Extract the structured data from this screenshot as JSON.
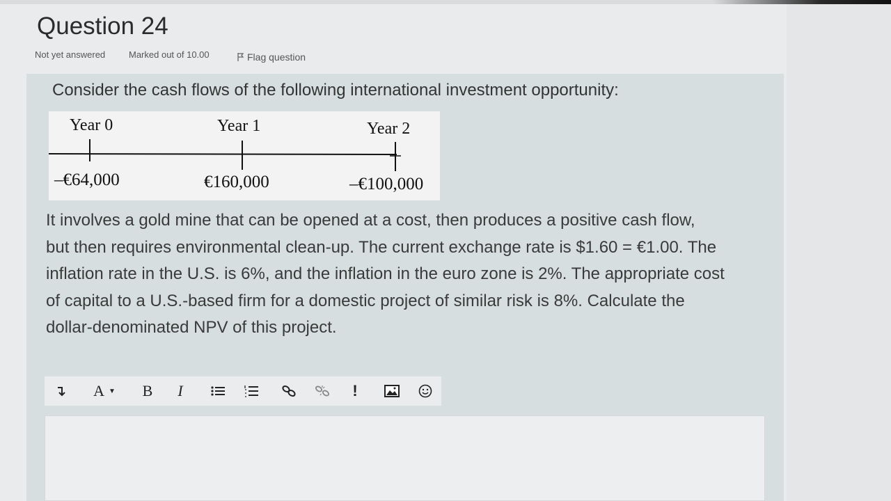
{
  "question": {
    "title": "Question 24",
    "status": "Not yet answered",
    "marks": "Marked out of 10.00",
    "flag_label": "Flag question"
  },
  "prompt": {
    "lead": "Consider the cash flows of the following international investment opportunity:",
    "timeline": {
      "years": [
        "Year 0",
        "Year 1",
        "Year 2"
      ],
      "cash_flows": [
        "–€64,000",
        "€160,000",
        "–€100,000"
      ]
    },
    "paragraph_lines": [
      "It involves a gold mine that can be opened at a cost, then produces a positive cash flow,",
      "but then requires environmental clean-up. The current exchange rate is $1.60 = €1.00. The",
      "inflation rate in the U.S. is 6%, and the inflation in the euro zone is 2%. The appropriate cost",
      "of capital to a U.S.-based firm for a domestic project of similar risk is 8%. Calculate the",
      "dollar-denominated NPV of this project."
    ]
  },
  "editor": {
    "toolbar": {
      "font_menu_label": "A",
      "bold_label": "B",
      "italic_label": "I",
      "special_label": "!"
    },
    "answer_text": ""
  }
}
